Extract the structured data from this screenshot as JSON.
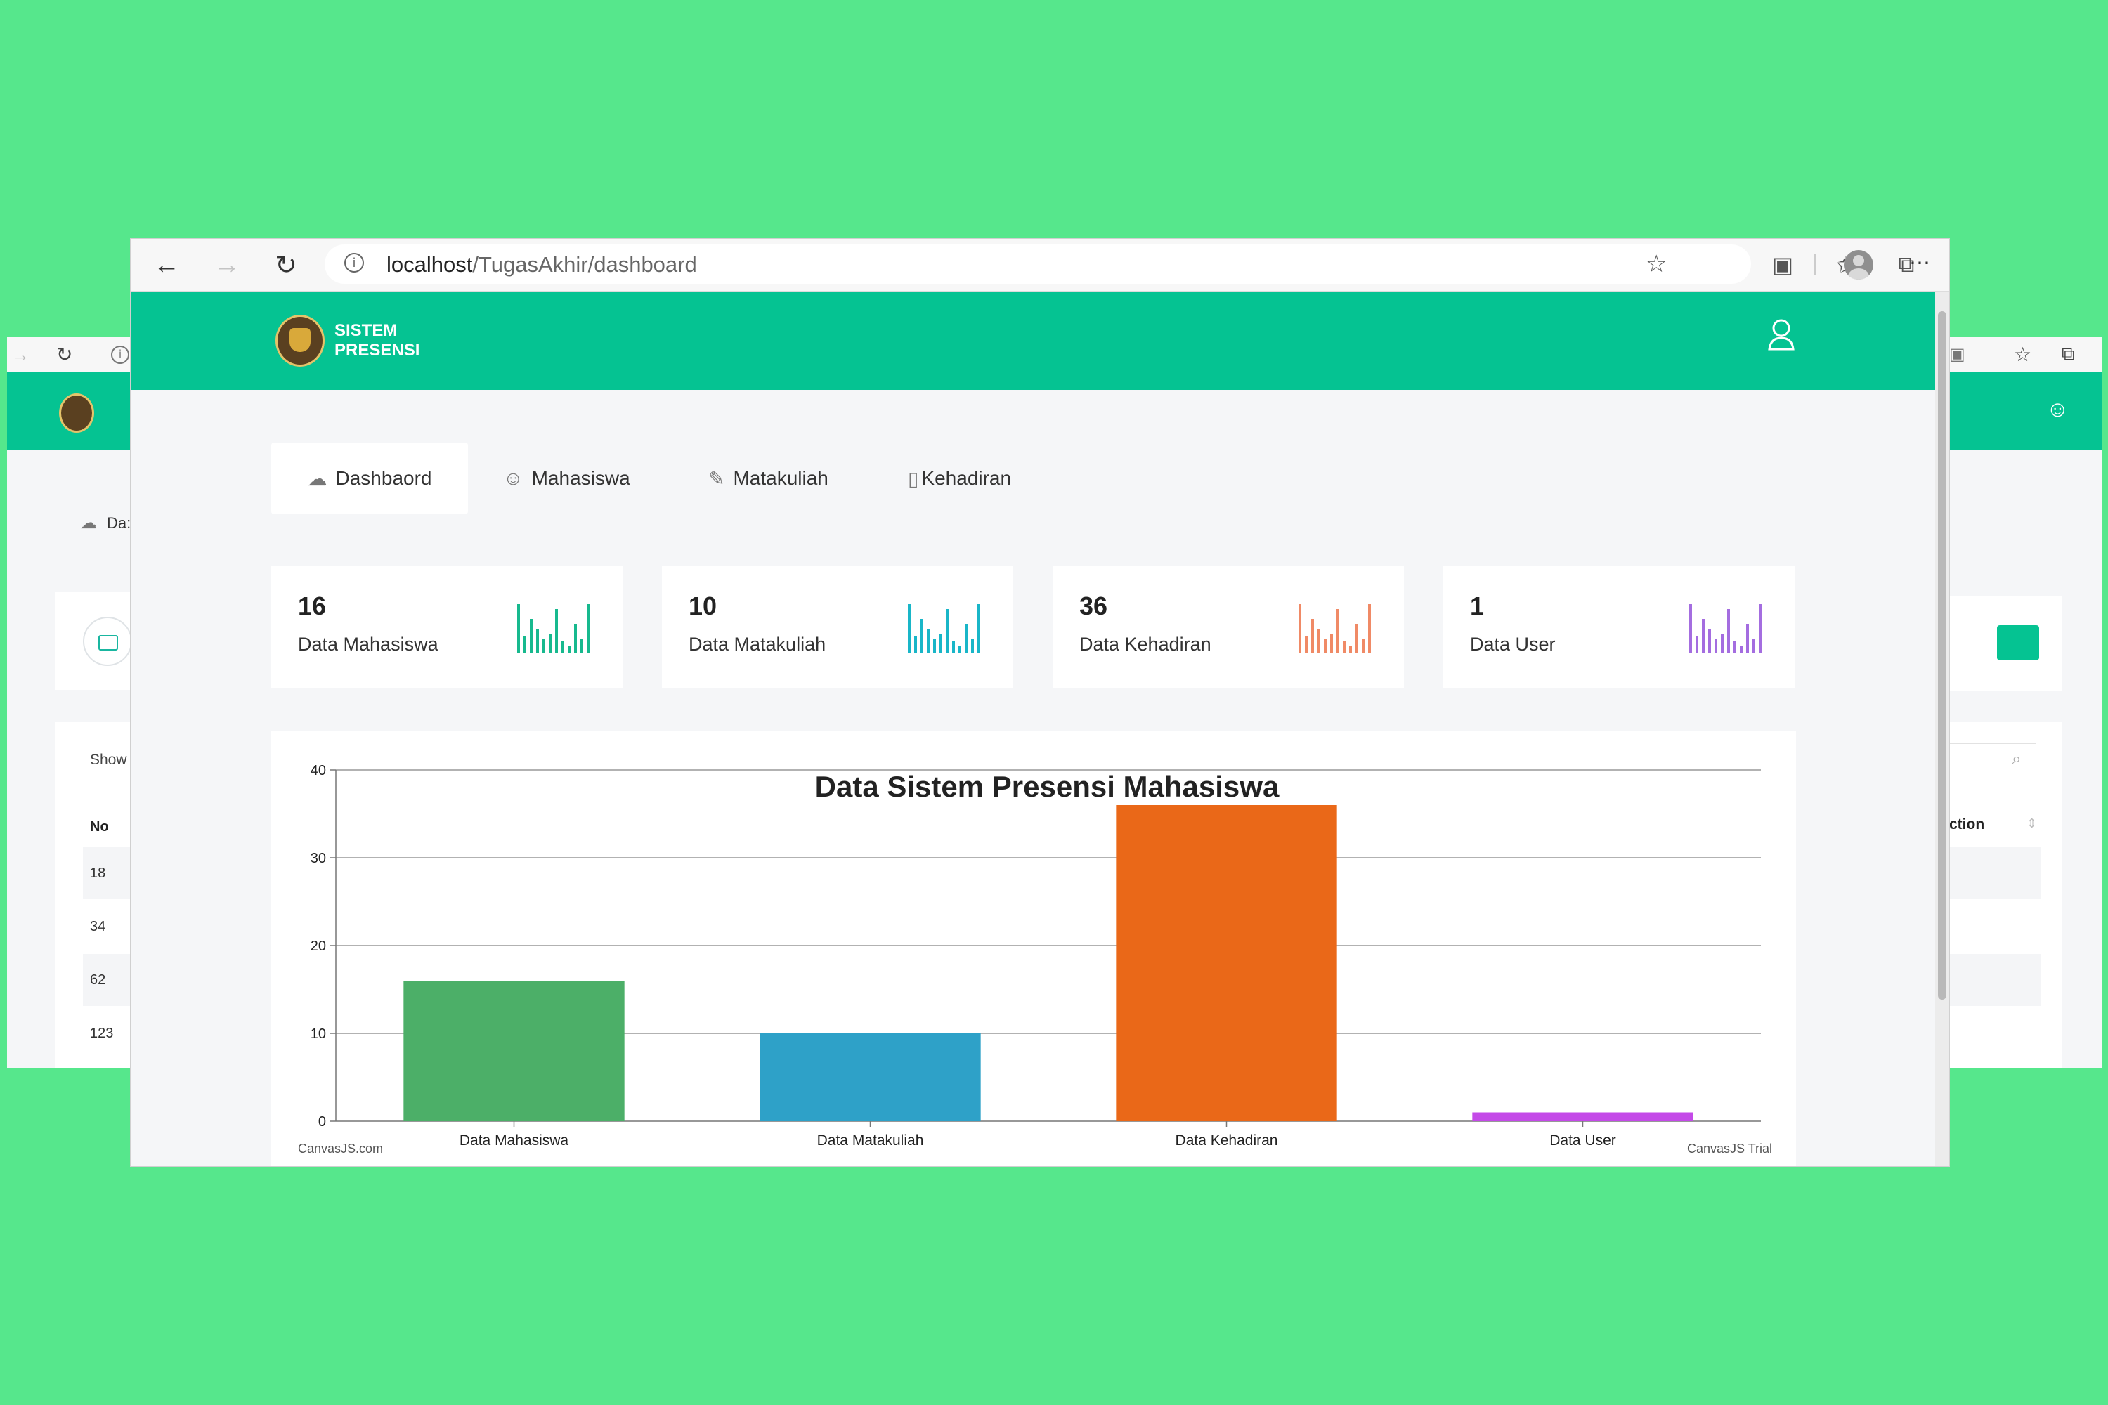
{
  "browser": {
    "url_host": "localhost",
    "url_path": "/TugasAkhir/dashboard"
  },
  "app": {
    "brand_line1": "SISTEM",
    "brand_line2": "PRESENSI"
  },
  "nav": {
    "tabs": [
      {
        "label": "Dashbaord",
        "icon": "dashboard-icon"
      },
      {
        "label": "Mahasiswa",
        "icon": "user-icon"
      },
      {
        "label": "Matakuliah",
        "icon": "edit-icon"
      },
      {
        "label": "Kehadiran",
        "icon": "book-icon"
      }
    ]
  },
  "stats": [
    {
      "value": "16",
      "label": "Data Mahasiswa",
      "color": "#17b98e"
    },
    {
      "value": "10",
      "label": "Data Matakuliah",
      "color": "#19b6c8"
    },
    {
      "value": "36",
      "label": "Data Kehadiran",
      "color": "#f08a66"
    },
    {
      "value": "1",
      "label": "Data User",
      "color": "#a46de0"
    }
  ],
  "background_left": {
    "tab_label": "Da:",
    "show_label": "Show",
    "col_no": "No",
    "rows": [
      "18",
      "34",
      "62",
      "123"
    ]
  },
  "background_right": {
    "col_action": "ction"
  },
  "chart_data": {
    "type": "bar",
    "title": "Data Sistem Presensi Mahasiswa",
    "categories": [
      "Data Mahasiswa",
      "Data Matakuliah",
      "Data Kehadiran",
      "Data User"
    ],
    "values": [
      16,
      10,
      36,
      1
    ],
    "colors": [
      "#4caf68",
      "#2ea1c8",
      "#ea6818",
      "#c44ae8"
    ],
    "ylim": [
      0,
      40
    ],
    "yticks": [
      0,
      10,
      20,
      30,
      40
    ],
    "grid": true,
    "watermark_left": "CanvasJS.com",
    "watermark_right": "CanvasJS Trial"
  }
}
